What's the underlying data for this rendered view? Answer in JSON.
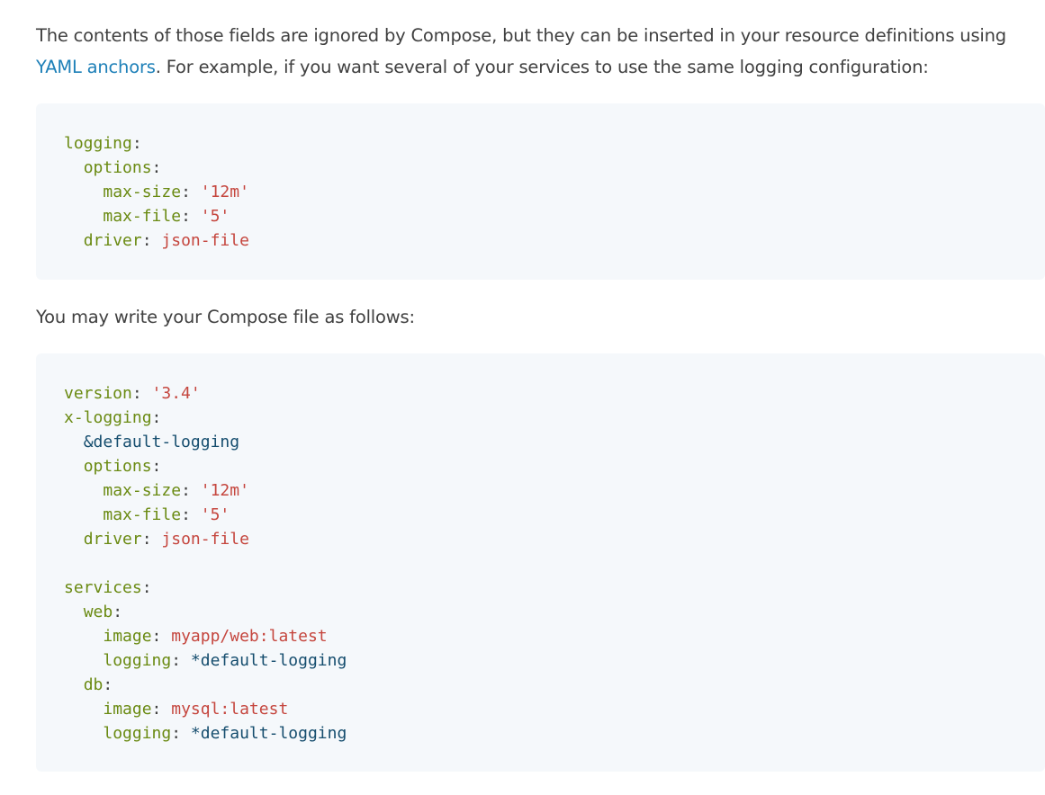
{
  "intro": {
    "text_before_link": "The contents of those fields are ignored by Compose, but they can be inserted in your resource definitions using ",
    "link_text": "YAML anchors",
    "text_after_link": ". For example, if you want several of your services to use the same logging configuration:"
  },
  "code1": [
    {
      "indent": "",
      "key": "logging",
      "value": "",
      "value_type": ""
    },
    {
      "indent": "  ",
      "key": "options",
      "value": "",
      "value_type": ""
    },
    {
      "indent": "    ",
      "key": "max-size",
      "value": "'12m'",
      "value_type": "s"
    },
    {
      "indent": "    ",
      "key": "max-file",
      "value": "'5'",
      "value_type": "s"
    },
    {
      "indent": "  ",
      "key": "driver",
      "value": "json-file",
      "value_type": "s"
    }
  ],
  "middle": {
    "text": "You may write your Compose file as follows:"
  },
  "code2": [
    {
      "indent": "",
      "key": "version",
      "value": "'3.4'",
      "value_type": "s"
    },
    {
      "indent": "",
      "key": "x-logging",
      "value": "",
      "value_type": ""
    },
    {
      "indent": "  ",
      "key": "",
      "value": "&default-logging",
      "value_type": "a"
    },
    {
      "indent": "  ",
      "key": "options",
      "value": "",
      "value_type": ""
    },
    {
      "indent": "    ",
      "key": "max-size",
      "value": "'12m'",
      "value_type": "s"
    },
    {
      "indent": "    ",
      "key": "max-file",
      "value": "'5'",
      "value_type": "s"
    },
    {
      "indent": "  ",
      "key": "driver",
      "value": "json-file",
      "value_type": "s"
    },
    {
      "indent": "",
      "key": "",
      "value": "",
      "value_type": ""
    },
    {
      "indent": "",
      "key": "services",
      "value": "",
      "value_type": ""
    },
    {
      "indent": "  ",
      "key": "web",
      "value": "",
      "value_type": ""
    },
    {
      "indent": "    ",
      "key": "image",
      "value": "myapp/web:latest",
      "value_type": "s"
    },
    {
      "indent": "    ",
      "key": "logging",
      "value": "*default-logging",
      "value_type": "a"
    },
    {
      "indent": "  ",
      "key": "db",
      "value": "",
      "value_type": ""
    },
    {
      "indent": "    ",
      "key": "image",
      "value": "mysql:latest",
      "value_type": "s"
    },
    {
      "indent": "    ",
      "key": "logging",
      "value": "*default-logging",
      "value_type": "a"
    }
  ],
  "colors": {
    "link": "#1e80b8",
    "code_background": "#f5f8fb",
    "yaml_key": "#6a8a12",
    "yaml_string": "#c5463e",
    "yaml_anchor": "#154d6e"
  }
}
